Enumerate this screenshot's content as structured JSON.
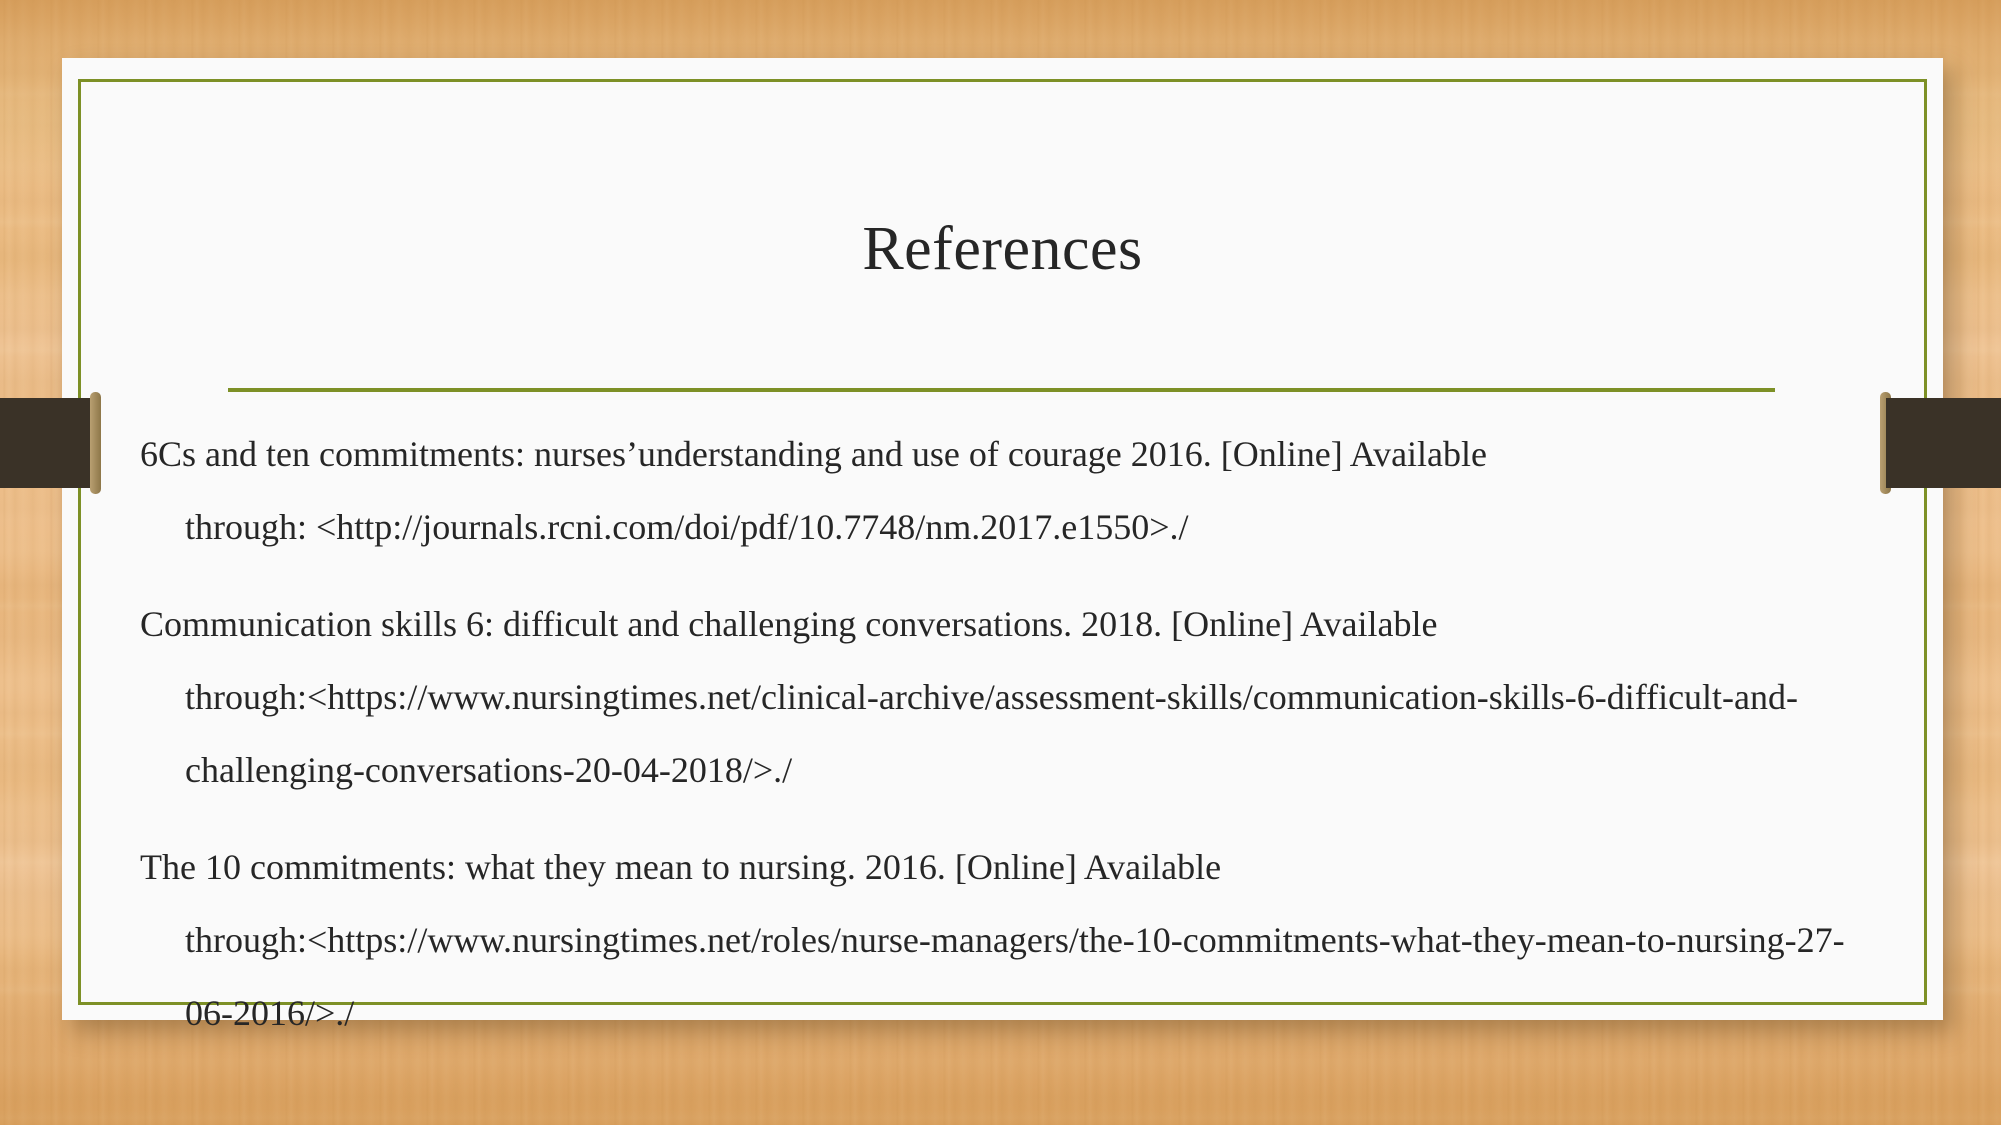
{
  "slide": {
    "title": "References",
    "background": "wood-texture",
    "colors": {
      "wood": "#e9b880",
      "card": "#fafafa",
      "accent_green": "#7d9026",
      "text": "#262626",
      "ribbon_dark": "#3a3227",
      "ribbon_cap": "#a8904f"
    }
  },
  "decorations": {
    "left_ribbon_label": "left-ribbon",
    "right_ribbon_label": "right-ribbon",
    "divider_label": "title-divider"
  },
  "references": [
    {
      "id": "ref-1",
      "citation": "6Cs and ten commitments: nurses’understanding and use of courage 2016. [Online] Available",
      "continuation": "through: <http://journals.rcni.com/doi/pdf/10.7748/nm.2017.e1550>./"
    },
    {
      "id": "ref-2",
      "citation": "Communication skills 6: difficult and challenging conversations. 2018. [Online] Available",
      "continuation": "through:<https://www.nursingtimes.net/clinical-archive/assessment-skills/communication-skills-6-difficult-and-challenging-conversations-20-04-2018/>./"
    },
    {
      "id": "ref-3",
      "citation": "The 10 commitments: what they mean to nursing. 2016. [Online] Available",
      "continuation": "through:<https://www.nursingtimes.net/roles/nurse-managers/the-10-commitments-what-they-mean-to-nursing-27-06-2016/>./"
    }
  ]
}
